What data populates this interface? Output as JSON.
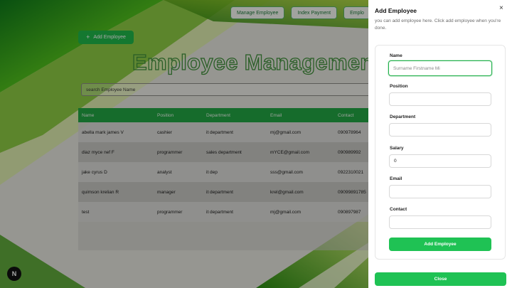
{
  "nav": {
    "items": [
      "Manage Employee",
      "Index Payment",
      "Emplo"
    ]
  },
  "main": {
    "add_button_label": "Add Employee",
    "title": "Employee Managemen",
    "search_placeholder": "search Employee Name",
    "table": {
      "columns": [
        "Name",
        "Position",
        "Department",
        "Email",
        "Contact"
      ],
      "rows": [
        [
          "abella mark james V",
          "cashier",
          "it department",
          "mj@gmail.com",
          "090978964"
        ],
        [
          "diaz myce nef F",
          "programmer",
          "sales department",
          "mYCE@gmail.com",
          "090989992"
        ],
        [
          "jake cyrus D",
          "analyst",
          "it dep",
          "sss@gmail.com",
          "0922310021"
        ],
        [
          "quimson krelian R",
          "manager",
          "it department",
          "krel@gmail.com",
          "09099891785"
        ],
        [
          "test",
          "programmer",
          "it department",
          "mj@gmail.com",
          "090897987"
        ]
      ]
    },
    "badge": "N"
  },
  "panel": {
    "title": "Add Employee",
    "close_glyph": "×",
    "description": "you can add employee here. Click add employee when you're done.",
    "fields": {
      "name": {
        "label": "Name",
        "placeholder": "Surname Firstname Mi",
        "value": ""
      },
      "position": {
        "label": "Position",
        "value": ""
      },
      "department": {
        "label": "Department",
        "value": ""
      },
      "salary": {
        "label": "Salary",
        "value": "0"
      },
      "email": {
        "label": "Email",
        "value": ""
      },
      "contact": {
        "label": "Contact",
        "value": ""
      }
    },
    "submit_label": "Add Employee",
    "close_label": "Close"
  },
  "colors": {
    "accent": "#1fc254",
    "table_header": "#22a544",
    "title_stroke": "#3f8f3a"
  }
}
